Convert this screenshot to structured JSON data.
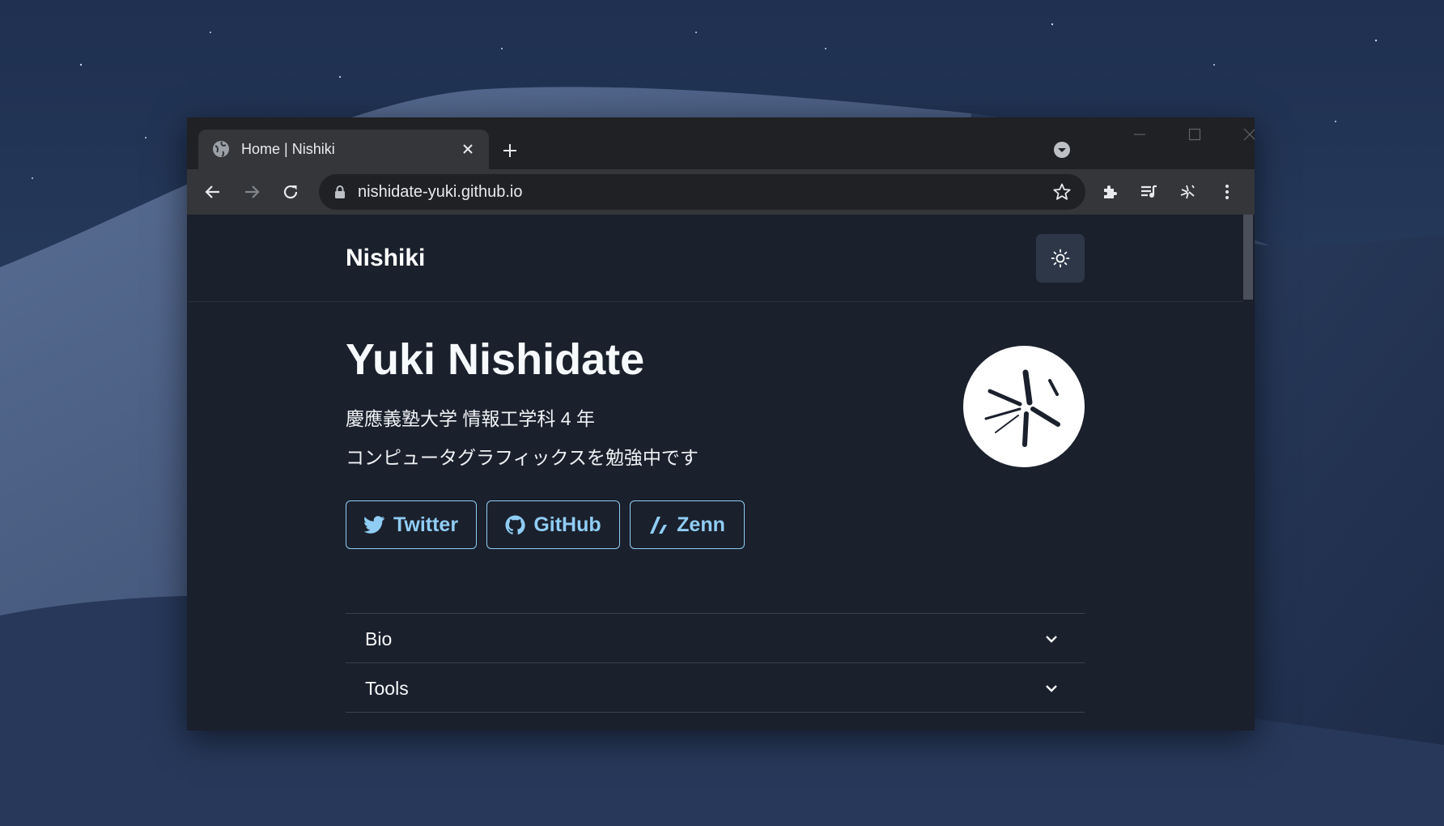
{
  "browser": {
    "tab_title": "Home | Nishiki",
    "url": "nishidate-yuki.github.io"
  },
  "site": {
    "brand": "Nishiki",
    "name": "Yuki Nishidate",
    "line1": "慶應義塾大学 情報工学科 4 年",
    "line2": "コンピュータグラフィックスを勉強中です",
    "links": {
      "twitter": "Twitter",
      "github": "GitHub",
      "zenn": "Zenn"
    },
    "accordion": {
      "bio": "Bio",
      "tools": "Tools"
    }
  },
  "colors": {
    "page_bg": "#1a202c",
    "link_accent": "#90cdf4",
    "chrome_frame": "#202124",
    "chrome_toolbar": "#35363a"
  }
}
